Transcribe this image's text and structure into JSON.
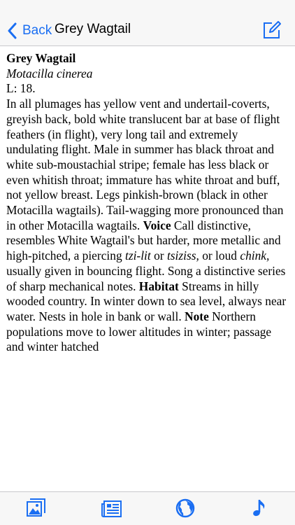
{
  "colors": {
    "accent": "#1a6ef2",
    "bar_bg": "#f7f7f7",
    "divider": "#c8c8cc"
  },
  "nav": {
    "back_label": "Back",
    "title": "Grey Wagtail",
    "compose_icon": "compose-icon"
  },
  "entry": {
    "name": "Grey Wagtail",
    "latin": "Motacilla cinerea",
    "length": "L: 18.",
    "desc_1": "In all plumages has yellow vent and undertail-coverts, greyish back, bold white translucent bar at base of flight feathers (in flight), very long tail and extremely undulating flight. Male in summer has black throat and white sub-moustachial stripe; female has less black or even whitish throat; immature has white throat and buff, not yellow breast. Legs pinkish-brown (black in other Motacilla wagtails). Tail-wagging more pronounced than in other Motacilla wagtails.",
    "voice_label": "Voice",
    "voice_1": "Call distinctive, resembles White Wagtail's but harder, more metallic and high-pitched, a piercing",
    "call_1": "tzi-lit",
    "voice_or": "or",
    "call_2": "tsiziss,",
    "voice_or_loud": "or loud",
    "call_3": "chink,",
    "voice_2": "usually given in bouncing flight. Song a distinctive series of sharp mechanical notes.",
    "habitat_label": "Habitat",
    "habitat": "Streams in hilly wooded country. In winter down to sea level, always near water. Nests in hole in bank or wall.",
    "note_label": "Note",
    "note": "Northern populations move to lower altitudes in winter; passage and winter hatched"
  },
  "tabs": [
    {
      "icon": "image-icon"
    },
    {
      "icon": "list-icon"
    },
    {
      "icon": "globe-icon"
    },
    {
      "icon": "music-note-icon"
    }
  ]
}
